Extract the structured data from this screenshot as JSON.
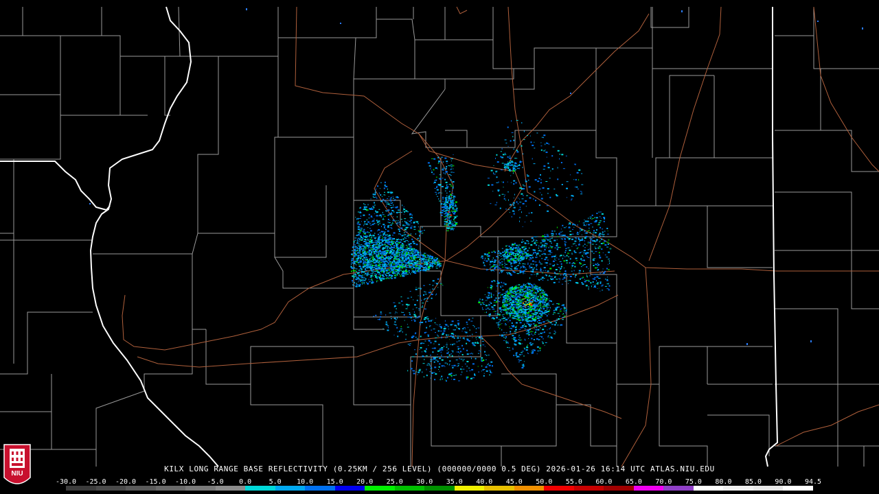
{
  "caption": {
    "station": "KILX",
    "product": "LONG RANGE BASE REFLECTIVITY",
    "resolution": "(0.25KM / 256 LEVEL)",
    "volume": "(000000/0000 0.5 DEG)",
    "timestamp": "2026-01-26 16:14 UTC",
    "source": "ATLAS.NIU.EDU"
  },
  "colorbar": {
    "labels": [
      "-30.0",
      "-25.0",
      "-20.0",
      "-15.0",
      "-10.0",
      "-5.0",
      "0.0",
      "5.0",
      "10.0",
      "15.0",
      "20.0",
      "25.0",
      "30.0",
      "35.0",
      "40.0",
      "45.0",
      "50.0",
      "55.0",
      "60.0",
      "65.0",
      "70.0",
      "75.0",
      "80.0",
      "85.0",
      "90.0",
      "94.5"
    ],
    "colors": [
      "#3c3c3c",
      "#4a4a4a",
      "#5a5a5a",
      "#6a6a6a",
      "#7a7a7a",
      "#8c8c8c",
      "#00d8d8",
      "#00a8f0",
      "#0070f0",
      "#0000f0",
      "#00f000",
      "#00c000",
      "#009000",
      "#f0f000",
      "#e8c000",
      "#f09000",
      "#f00000",
      "#c80000",
      "#a00000",
      "#f000f0",
      "#9040c8",
      "#ffffff",
      "#f0f0f0",
      "#e8e8e8",
      "#ffffff"
    ]
  },
  "map": {
    "colors": {
      "state_border": "#ffffff",
      "county_border": "#a0a0a0",
      "highway": "#b0603c",
      "background": "#000000"
    },
    "echo_clusters": [
      {
        "name": "west-fan",
        "intensity": "light-moderate"
      },
      {
        "name": "north-streak",
        "intensity": "light-moderate"
      },
      {
        "name": "northeast-patch",
        "intensity": "light"
      },
      {
        "name": "east-fan",
        "intensity": "light-moderate"
      },
      {
        "name": "southeast-core",
        "intensity": "moderate-heavy"
      },
      {
        "name": "south-scatter",
        "intensity": "light"
      }
    ]
  },
  "logo": {
    "text": "NIU",
    "color": "#c8102e"
  }
}
